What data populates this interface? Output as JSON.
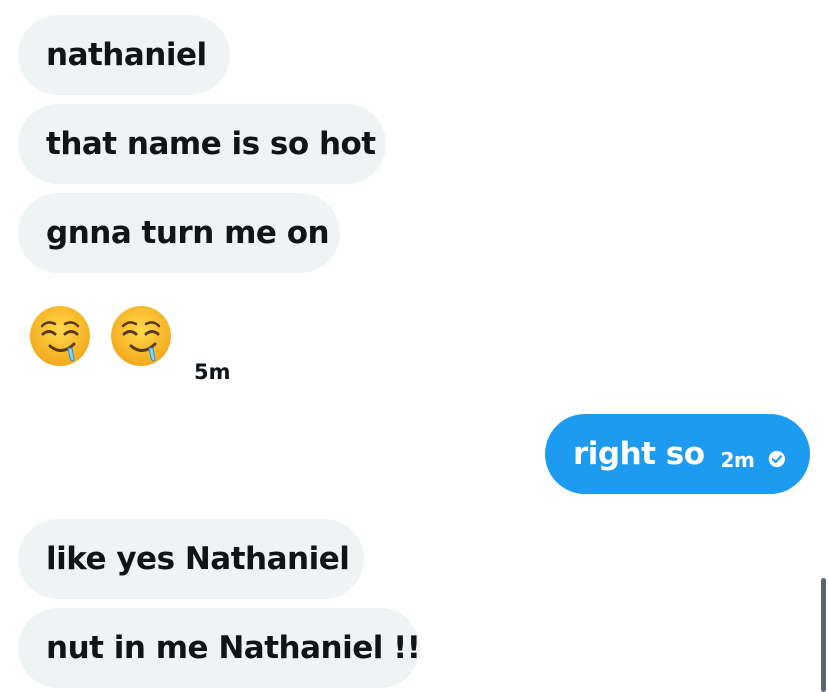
{
  "messages": [
    {
      "text": "nathaniel"
    },
    {
      "text": "that name is so hot"
    },
    {
      "text": "gnna turn me on"
    }
  ],
  "emoji_message": {
    "emojis": [
      "drooling-face-icon",
      "drooling-face-icon"
    ],
    "time": "5m"
  },
  "sent": {
    "text": "right so",
    "time": "2m",
    "status_icon": "check-circle-icon"
  },
  "later": [
    {
      "text": "like yes Nathaniel"
    },
    {
      "text": "nut in me Nathaniel !!"
    }
  ],
  "colors": {
    "incoming_bubble": "#eff3f4",
    "outgoing_bubble": "#1d9bf0",
    "text": "#0f1419"
  }
}
